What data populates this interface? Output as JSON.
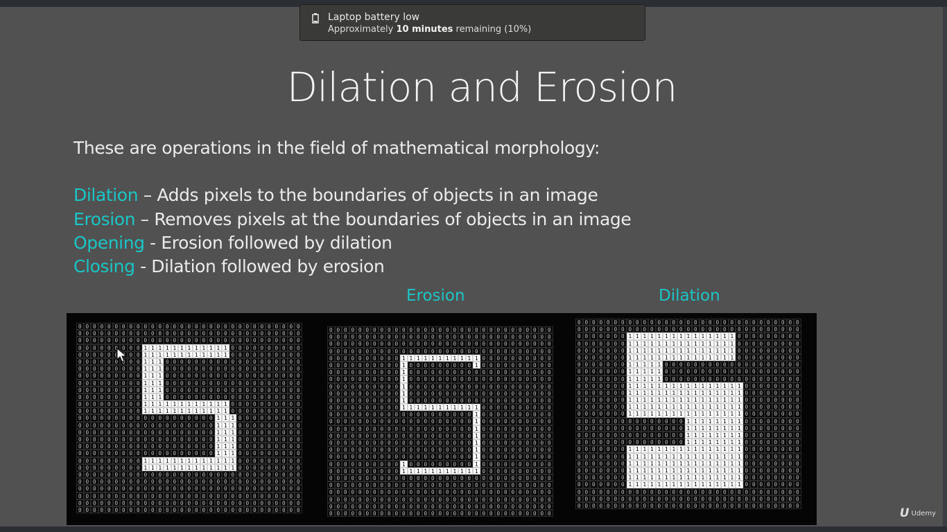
{
  "notification": {
    "title": "Laptop battery low",
    "body_prefix": "Approximately ",
    "body_bold": "10 minutes",
    "body_suffix": " remaining (10%)",
    "icon": "battery-icon"
  },
  "slide": {
    "title": "Dilation and Erosion",
    "intro": "These are operations in the field of mathematical morphology:",
    "items": [
      {
        "term": "Dilation",
        "desc": " – Adds pixels to the boundaries of objects in an image"
      },
      {
        "term": "Erosion",
        "desc": " – Removes pixels at the boundaries of objects in an image"
      },
      {
        "term": "Opening",
        "desc": " - Erosion followed by dilation"
      },
      {
        "term": "Closing",
        "desc": " - Dilation followed by erosion"
      }
    ],
    "captions": {
      "erosion": "Erosion",
      "dilation": "Dilation"
    },
    "accent_color": "#1cc5c5",
    "matrices": {
      "original": [
        "0000000000000000000000000000000",
        "0000000000000000000000000000000",
        "0000000000000000000000000000000",
        "0000000001111111111110000000000",
        "0000000001111111111110000000000",
        "0000000001110000000000000000000",
        "0000000001110000000000000000000",
        "0000000001110000000000000000000",
        "0000000001110000000000000000000",
        "0000000001110000000000000000000",
        "0000000001110000000000000000000",
        "0000000001111111111110000000000",
        "0000000001111111111110000000000",
        "0000000000000000000111000000000",
        "0000000000000000000111000000000",
        "0000000000000000000111000000000",
        "0000000000000000000111000000000",
        "0000000000000000000111000000000",
        "0000000000000000000111000000000",
        "0000000001111111111111000000000",
        "0000000001111111111111000000000",
        "0000000000000000000000000000000",
        "0000000000000000000000000000000",
        "0000000000000000000000000000000",
        "0000000000000000000000000000000",
        "0000000000000000000000000000000",
        "0000000000000000000000000000000"
      ],
      "erosion": [
        "0000000000000000000000000000000",
        "0000000000000000000000000000000",
        "0000000000000000000000000000000",
        "0000000000000000000000000000000",
        "0000000000111111111110000000000",
        "0000000000100000000010000000000",
        "0000000000100000000000000000000",
        "0000000000100000000000000000000",
        "0000000000100000000000000000000",
        "0000000000100000000000000000000",
        "0000000000100000000000000000000",
        "0000000000111111111110000000000",
        "0000000000000000000010000000000",
        "0000000000000000000010000000000",
        "0000000000000000000010000000000",
        "0000000000000000000010000000000",
        "0000000000000000000010000000000",
        "0000000000000000000010000000000",
        "0000000000000000000010000000000",
        "0000000000100000000010000000000",
        "0000000000111111111110000000000",
        "0000000000000000000000000000000",
        "0000000000000000000000000000000",
        "0000000000000000000000000000000",
        "0000000000000000000000000000000",
        "0000000000000000000000000000000",
        "0000000000000000000000000000000"
      ],
      "dilation": [
        "0000000000000000000000000000000",
        "0000000000000000000000000000000",
        "0000000111111111111111000000000",
        "0000000111111111111111000000000",
        "0000000111111111111111000000000",
        "0000000111111111111111000000000",
        "0000000111110000000000000000000",
        "0000000111110000000000000000000",
        "0000000111110000000000000000000",
        "0000000111111111111111100000000",
        "0000000111111111111111100000000",
        "0000000111111111111111100000000",
        "0000000111111111111111100000000",
        "0000000111111111111111100000000",
        "0000000000000001111111100000000",
        "0000000000000001111111100000000",
        "0000000000000001111111100000000",
        "0000000000000001111111100000000",
        "0000000111111111111111100000000",
        "0000000111111111111111100000000",
        "0000000111111111111111100000000",
        "0000000111111111111111100000000",
        "0000000111111111111111100000000",
        "0000000111111111111111100000000",
        "0000000000000000000000000000000",
        "0000000000000000000000000000000",
        "0000000000000000000000000000000"
      ]
    }
  },
  "watermark": {
    "glyph": "U",
    "label": "Udemy"
  }
}
